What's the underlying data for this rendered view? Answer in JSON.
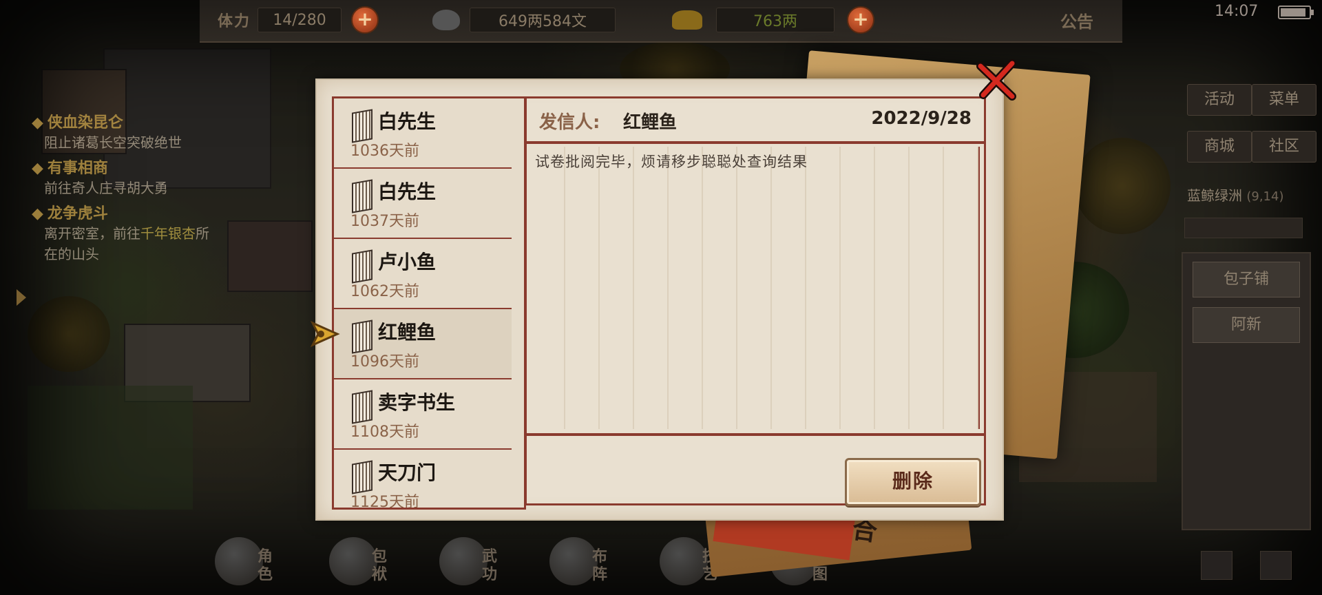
{
  "topbar": {
    "stamina_label": "体力",
    "stamina_value": "14/280",
    "money_value": "649两584文",
    "gold_value": "763两",
    "notice_label": "公告",
    "time": "14:07"
  },
  "quests": [
    {
      "title": "侠血染昆仑",
      "desc": "阻止诸葛长空突破绝世"
    },
    {
      "title": "有事相商",
      "desc": "前往奇人庄寻胡大勇"
    },
    {
      "title": "龙争虎斗",
      "desc_parts": [
        "离开密室，前往",
        "千年银杏",
        "所在的山头"
      ]
    }
  ],
  "right_menu": {
    "activity": "活动",
    "menu": "菜单",
    "shop": "商城",
    "community": "社区",
    "location": "蓝鲸绿洲",
    "coords": "(9,14)",
    "npc_list": [
      "包子铺",
      "阿新"
    ]
  },
  "bottom_bar": [
    "角色",
    "包袱",
    "武功",
    "布阵",
    "技艺",
    "地图"
  ],
  "mail": {
    "items": [
      {
        "sender": "白先生",
        "age": "1036天前"
      },
      {
        "sender": "白先生",
        "age": "1037天前"
      },
      {
        "sender": "卢小鱼",
        "age": "1062天前"
      },
      {
        "sender": "红鲤鱼",
        "age": "1096天前"
      },
      {
        "sender": "卖字书生",
        "age": "1108天前"
      },
      {
        "sender": "天刀门",
        "age": "1125天前"
      }
    ],
    "selected_index": 3,
    "sender_label": "发信人:",
    "sender": "红鲤鱼",
    "date": "2022/9/28",
    "body": "试卷批阅完毕，烦请移步聪聪处查询结果",
    "delete_label": "删除"
  },
  "colors": {
    "frame_red": "#8a3a2e",
    "paper": "#e9e0d0",
    "accent_gold": "#c9a24a"
  }
}
